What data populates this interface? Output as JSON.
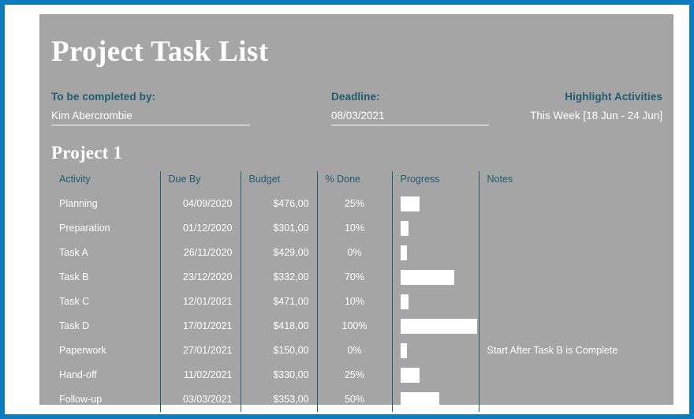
{
  "document": {
    "title": "Project Task List",
    "project_heading": "Project 1"
  },
  "header": {
    "completed_by": {
      "label": "To be completed by:",
      "value": "Kim Abercrombie"
    },
    "deadline": {
      "label": "Deadline:",
      "value": "08/03/2021"
    },
    "highlight": {
      "label": "Highlight Activities",
      "value": "This Week [18 Jun - 24 Jun]"
    }
  },
  "table": {
    "columns": [
      {
        "key": "activity",
        "label": "Activity",
        "align": "left"
      },
      {
        "key": "due_by",
        "label": "Due By",
        "align": "right"
      },
      {
        "key": "budget",
        "label": "Budget",
        "align": "right"
      },
      {
        "key": "percent",
        "label": "% Done",
        "align": "center"
      },
      {
        "key": "progress",
        "label": "Progress",
        "align": "left"
      },
      {
        "key": "notes",
        "label": "Notes",
        "align": "left"
      }
    ],
    "rows": [
      {
        "activity": "Planning",
        "due_by": "04/09/2020",
        "budget": "$476,00",
        "percent": "25%",
        "percent_value": 25,
        "notes": ""
      },
      {
        "activity": "Preparation",
        "due_by": "01/12/2020",
        "budget": "$301,00",
        "percent": "10%",
        "percent_value": 10,
        "notes": ""
      },
      {
        "activity": "Task A",
        "due_by": "26/11/2020",
        "budget": "$429,00",
        "percent": "0%",
        "percent_value": 0,
        "notes": ""
      },
      {
        "activity": "Task B",
        "due_by": "23/12/2020",
        "budget": "$332,00",
        "percent": "70%",
        "percent_value": 70,
        "notes": ""
      },
      {
        "activity": "Task C",
        "due_by": "12/01/2021",
        "budget": "$471,00",
        "percent": "10%",
        "percent_value": 10,
        "notes": ""
      },
      {
        "activity": "Task D",
        "due_by": "17/01/2021",
        "budget": "$418,00",
        "percent": "100%",
        "percent_value": 100,
        "notes": ""
      },
      {
        "activity": "Paperwork",
        "due_by": "27/01/2021",
        "budget": "$150,00",
        "percent": "0%",
        "percent_value": 0,
        "notes": "Start After Task B is Complete"
      },
      {
        "activity": "Hand-off",
        "due_by": "11/02/2021",
        "budget": "$330,00",
        "percent": "25%",
        "percent_value": 25,
        "notes": ""
      },
      {
        "activity": "Follow-up",
        "due_by": "03/03/2021",
        "budget": "$353,00",
        "percent": "50%",
        "percent_value": 50,
        "notes": ""
      }
    ]
  },
  "colors": {
    "frame": "#0C7CBE",
    "sheet": "#a5a5a5",
    "accent_teal": "#1F5B6E",
    "text_light": "#ffffff",
    "bar_fill": "#ffffff"
  }
}
